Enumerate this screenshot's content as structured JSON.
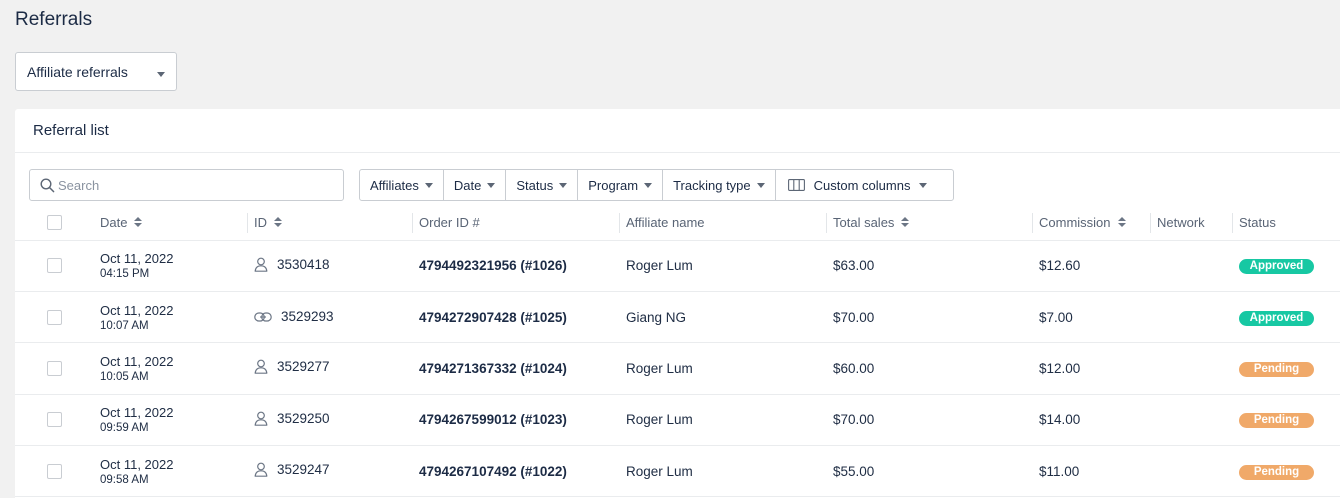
{
  "page": {
    "title": "Referrals",
    "view_select": "Affiliate referrals"
  },
  "card": {
    "title": "Referral list",
    "search": {
      "placeholder": "Search"
    },
    "filters": [
      "Affiliates",
      "Date",
      "Status",
      "Program",
      "Tracking type",
      "Custom columns"
    ]
  },
  "table": {
    "headers": {
      "date": "Date",
      "id": "ID",
      "order_id": "Order ID #",
      "affiliate_name": "Affiliate name",
      "total_sales": "Total sales",
      "commission": "Commission",
      "network": "Network",
      "status": "Status"
    },
    "rows": [
      {
        "date": "Oct 11, 2022",
        "time": "04:15 PM",
        "id_icon": "person-icon",
        "id": "3530418",
        "order": "4794492321956 (#1026)",
        "affiliate": "Roger Lum",
        "sales": "$63.00",
        "commission": "$12.60",
        "network": "",
        "status": "Approved"
      },
      {
        "date": "Oct 11, 2022",
        "time": "10:07 AM",
        "id_icon": "link-icon",
        "id": "3529293",
        "order": "4794272907428 (#1025)",
        "affiliate": "Giang NG",
        "sales": "$70.00",
        "commission": "$7.00",
        "network": "",
        "status": "Approved"
      },
      {
        "date": "Oct 11, 2022",
        "time": "10:05 AM",
        "id_icon": "person-icon",
        "id": "3529277",
        "order": "4794271367332 (#1024)",
        "affiliate": "Roger Lum",
        "sales": "$60.00",
        "commission": "$12.00",
        "network": "",
        "status": "Pending"
      },
      {
        "date": "Oct 11, 2022",
        "time": "09:59 AM",
        "id_icon": "person-icon",
        "id": "3529250",
        "order": "4794267599012 (#1023)",
        "affiliate": "Roger Lum",
        "sales": "$70.00",
        "commission": "$14.00",
        "network": "",
        "status": "Pending"
      },
      {
        "date": "Oct 11, 2022",
        "time": "09:58 AM",
        "id_icon": "person-icon",
        "id": "3529247",
        "order": "4794267107492 (#1022)",
        "affiliate": "Roger Lum",
        "sales": "$55.00",
        "commission": "$11.00",
        "network": "",
        "status": "Pending"
      }
    ]
  },
  "colors": {
    "approved": "#17c8a3",
    "pending": "#f0a969"
  }
}
